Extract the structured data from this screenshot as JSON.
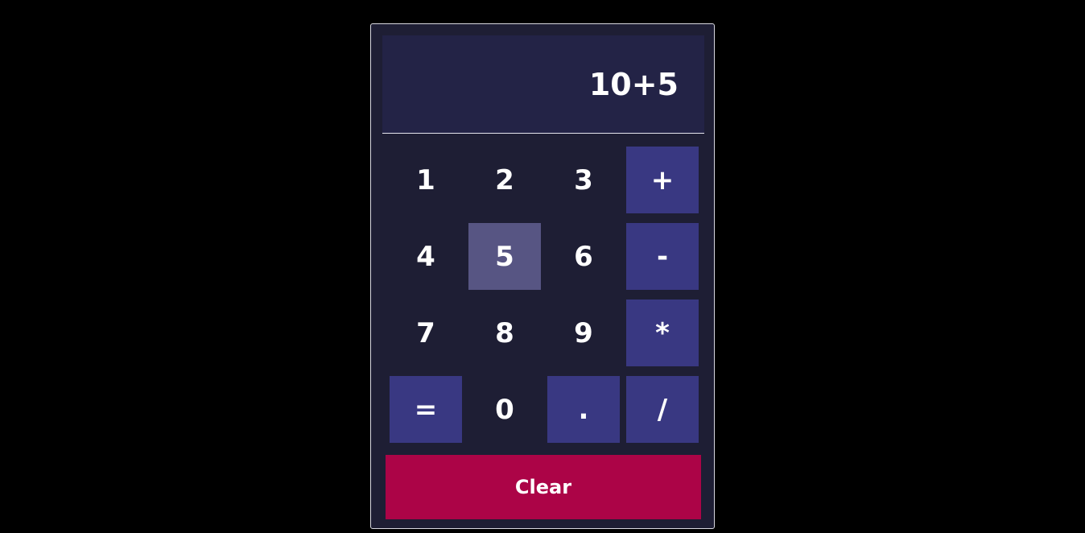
{
  "display": {
    "value": "10+5"
  },
  "keys": {
    "one": "1",
    "two": "2",
    "three": "3",
    "plus": "+",
    "four": "4",
    "five": "5",
    "six": "6",
    "minus": "-",
    "seven": "7",
    "eight": "8",
    "nine": "9",
    "multiply": "*",
    "equals": "=",
    "zero": "0",
    "dot": ".",
    "divide": "/"
  },
  "clear": {
    "label": "Clear"
  },
  "colors": {
    "background": "#000000",
    "panel": "#1e1e34",
    "display": "#232346",
    "operator": "#393882",
    "pressed": "#575583",
    "clear": "#ac0447",
    "text": "#ffffff"
  }
}
